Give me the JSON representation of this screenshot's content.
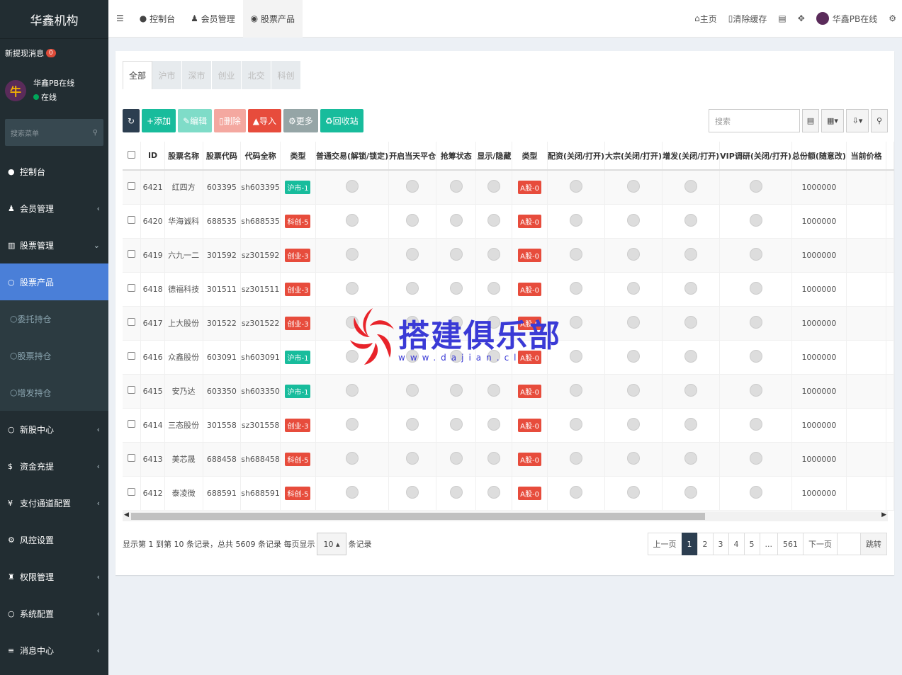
{
  "sidebar": {
    "logo": "华鑫机构",
    "notice": "新提现消息",
    "notice_count": "0",
    "user_name": "华鑫PB在线",
    "user_status": "在线",
    "search_placeholder": "搜索菜单",
    "menu": [
      {
        "label": "控制台",
        "icon": "dashboard-icon"
      },
      {
        "label": "会员管理",
        "icon": "user-icon"
      },
      {
        "label": "股票管理",
        "icon": "bank-icon"
      },
      {
        "label": "股票产品",
        "icon": "circle-icon"
      },
      {
        "label": "委托持仓",
        "icon": "circle-icon"
      },
      {
        "label": "股票持仓",
        "icon": "circle-icon"
      },
      {
        "label": "增发持仓",
        "icon": "circle-icon"
      },
      {
        "label": "新股中心",
        "icon": "circle-icon"
      },
      {
        "label": "资金充提",
        "icon": "dollar-icon"
      },
      {
        "label": "支付通道配置",
        "icon": "yen-icon"
      },
      {
        "label": "风控设置",
        "icon": "gear-icon"
      },
      {
        "label": "权限管理",
        "icon": "group-icon"
      },
      {
        "label": "系统配置",
        "icon": "circle-icon"
      },
      {
        "label": "消息中心",
        "icon": "list-icon"
      }
    ]
  },
  "topbar": {
    "tabs": [
      "控制台",
      "会员管理",
      "股票产品"
    ],
    "home": "主页",
    "clear_cache": "清除缓存",
    "user": "华鑫PB在线"
  },
  "main": {
    "tabs": [
      "全部",
      "沪市",
      "深市",
      "创业",
      "北交",
      "科创"
    ],
    "buttons": {
      "add": "添加",
      "edit": "编辑",
      "delete": "删除",
      "import": "导入",
      "more": "更多",
      "recycle": "回收站"
    },
    "search_placeholder": "搜索",
    "columns": [
      "ID",
      "股票名称",
      "股票代码",
      "代码全称",
      "类型",
      "普通交易(解锁/锁定)",
      "开启当天平仓",
      "抢筹状态",
      "显示/隐藏",
      "类型",
      "配资(关闭/打开)",
      "大宗(关闭/打开)",
      "增发(关闭/打开)",
      "VIP调研(关闭/打开)",
      "总份额(随意改)",
      "当前价格"
    ],
    "rows": [
      {
        "id": "6421",
        "name": "红四方",
        "code": "603395",
        "full": "sh603395",
        "type": "沪市-1",
        "type_color": "#18bc9c",
        "type2": "A股-0",
        "total": "1000000"
      },
      {
        "id": "6420",
        "name": "华海诚科",
        "code": "688535",
        "full": "sh688535",
        "type": "科创-5",
        "type_color": "#e74c3c",
        "type2": "A股-0",
        "total": "1000000"
      },
      {
        "id": "6419",
        "name": "六九一二",
        "code": "301592",
        "full": "sz301592",
        "type": "创业-3",
        "type_color": "#e74c3c",
        "type2": "A股-0",
        "total": "1000000"
      },
      {
        "id": "6418",
        "name": "德福科技",
        "code": "301511",
        "full": "sz301511",
        "type": "创业-3",
        "type_color": "#e74c3c",
        "type2": "A股-0",
        "total": "1000000"
      },
      {
        "id": "6417",
        "name": "上大股份",
        "code": "301522",
        "full": "sz301522",
        "type": "创业-3",
        "type_color": "#e74c3c",
        "type2": "A股-0",
        "total": "1000000"
      },
      {
        "id": "6416",
        "name": "众鑫股份",
        "code": "603091",
        "full": "sh603091",
        "type": "沪市-1",
        "type_color": "#18bc9c",
        "type2": "A股-0",
        "total": "1000000"
      },
      {
        "id": "6415",
        "name": "安乃达",
        "code": "603350",
        "full": "sh603350",
        "type": "沪市-1",
        "type_color": "#18bc9c",
        "type2": "A股-0",
        "total": "1000000"
      },
      {
        "id": "6414",
        "name": "三态股份",
        "code": "301558",
        "full": "sz301558",
        "type": "创业-3",
        "type_color": "#e74c3c",
        "type2": "A股-0",
        "total": "1000000"
      },
      {
        "id": "6413",
        "name": "美芯晟",
        "code": "688458",
        "full": "sh688458",
        "type": "科创-5",
        "type_color": "#e74c3c",
        "type2": "A股-0",
        "total": "1000000"
      },
      {
        "id": "6412",
        "name": "泰凌微",
        "code": "688591",
        "full": "sh688591",
        "type": "科创-5",
        "type_color": "#e74c3c",
        "type2": "A股-0",
        "total": "1000000"
      }
    ],
    "footer_text": "显示第 1 到第 10 条记录，总共 5609 条记录 每页显示",
    "page_size": "10",
    "footer_suffix": "条记录",
    "pager": [
      "上一页",
      "1",
      "2",
      "3",
      "4",
      "5",
      "...",
      "561",
      "下一页"
    ],
    "jump": "跳转"
  },
  "watermark": {
    "title": "搭建俱乐部",
    "url": "www.dajian.cl"
  }
}
